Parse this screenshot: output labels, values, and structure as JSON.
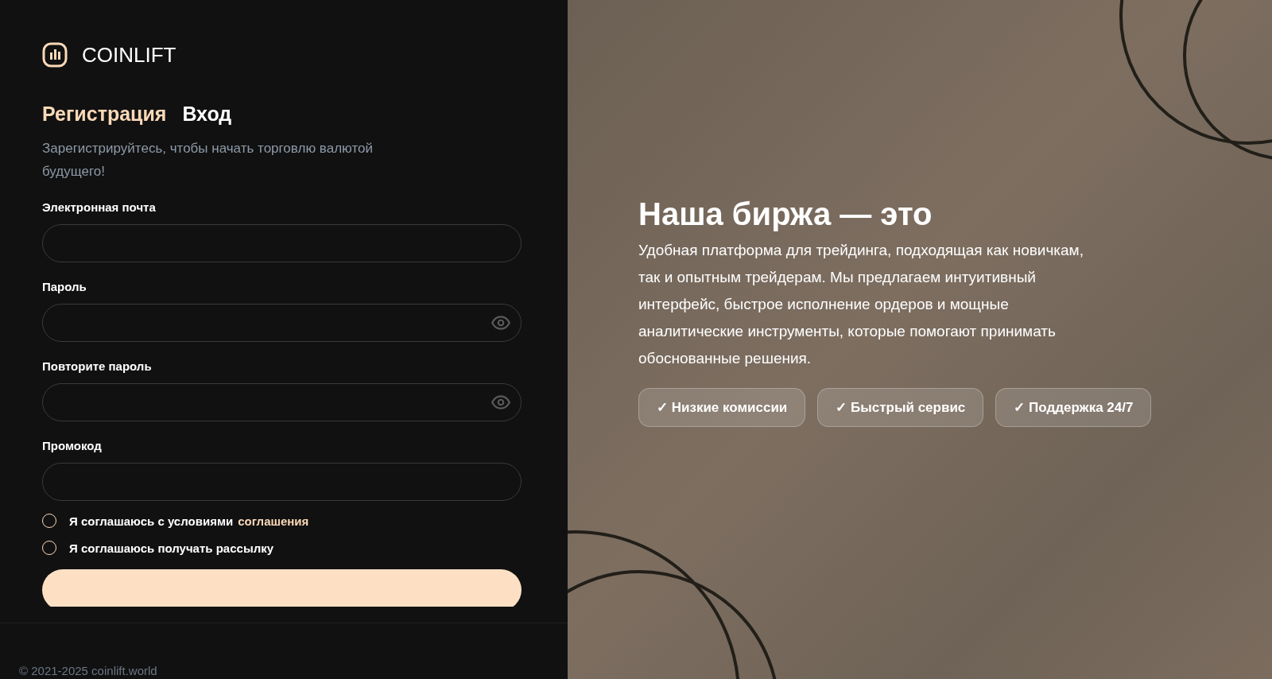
{
  "brand": {
    "name": "COINLIFT"
  },
  "tabs": [
    {
      "label": "Регистрация",
      "selected": true
    },
    {
      "label": "Вход",
      "selected": false
    }
  ],
  "subtitle": "Зарегистрируйтесь, чтобы начать торговлю валютой будущего!",
  "fields": [
    {
      "label": "Электронная почта",
      "kind": "text"
    },
    {
      "label": "Пароль",
      "kind": "password"
    },
    {
      "label": "Повторите пароль",
      "kind": "password"
    },
    {
      "label": "Промокод",
      "kind": "text"
    }
  ],
  "agreements": [
    {
      "text": "Я соглашаюсь с условиями",
      "link": "соглашения",
      "checked": false
    },
    {
      "text": "Я соглашаюсь получать рассылку",
      "checked": false
    }
  ],
  "footer": "© 2021-2025 coinlift.world",
  "promo": {
    "title": "Наша биржа — это",
    "text": "Удобная платформа для трейдинга, подходящая как новичкам, так и опытным трейдерам. Мы предлагаем интуитивный интерфейс, быстрое исполнение ордеров и мощные аналитические инструменты, которые помогают принимать обоснованные решения.",
    "features": [
      "✓ Низкие комиссии",
      "✓ Быстрый сервис",
      "✓ Поддержка 24/7"
    ]
  }
}
